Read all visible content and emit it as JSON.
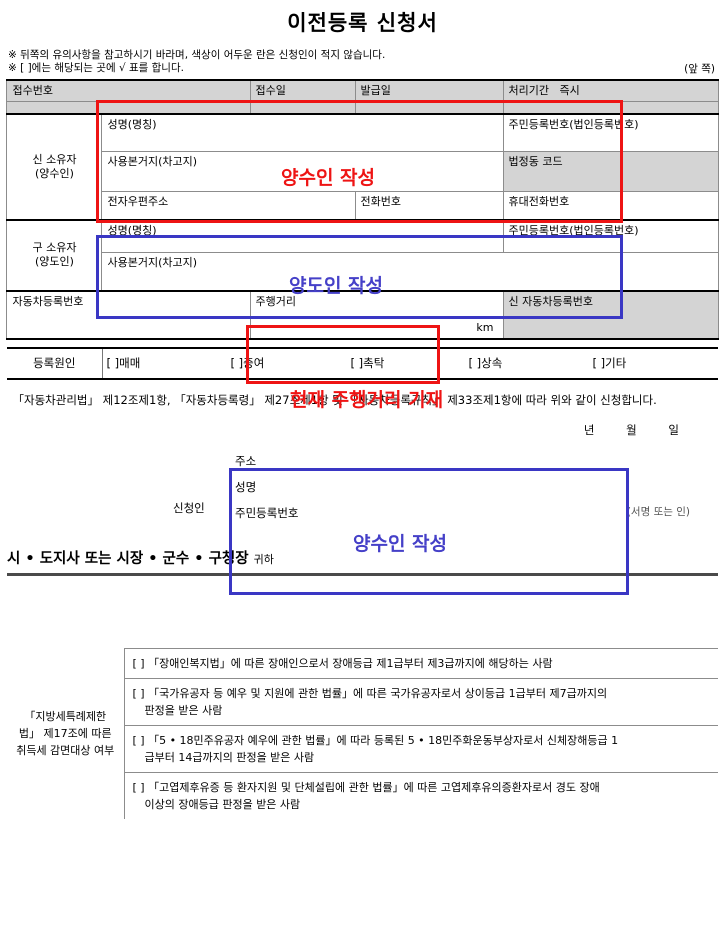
{
  "document": {
    "title": "이전등록 신청서",
    "page_mark": "(앞 쪽)",
    "notices": [
      "※ 뒤쪽의 유의사항을 참고하시기 바라며, 색상이 어두운 란은 신청인이 적지 않습니다.",
      "※ [ ]에는 해당되는 곳에 √ 표를 합니다."
    ]
  },
  "receipt_row": {
    "receipt_no_label": "접수번호",
    "receipt_date_label": "접수일",
    "issue_date_label": "발급일",
    "processing_label": "처리기간",
    "processing_value": "즉시"
  },
  "new_owner": {
    "section_label": "신 소유자",
    "section_sub": "(양수인)",
    "name_label": "성명(명칭)",
    "id_label": "주민등록번호(법인등록번호)",
    "address_label": "사용본거지(차고지)",
    "dong_code_label": "법정동 코드",
    "email_label": "전자우편주소",
    "phone_label": "전화번호",
    "mobile_label": "휴대전화번호"
  },
  "old_owner": {
    "section_label": "구 소유자",
    "section_sub": "(양도인)",
    "name_label": "성명(명칭)",
    "id_label": "주민등록번호(법인등록번호)",
    "address_label": "사용본거지(차고지)"
  },
  "vehicle": {
    "reg_no_label": "자동차등록번호",
    "mileage_label": "주행거리",
    "mileage_unit": "km",
    "new_reg_no_label": "신 자동차등록번호"
  },
  "reason": {
    "label": "등록원인",
    "options": [
      "[  ]매매",
      "[  ]증여",
      "[  ]촉탁",
      "[  ]상속",
      "[  ]기타"
    ]
  },
  "statute": {
    "text": "「자동차관리법」 제12조제1항, 「자동차등록령」 제27조제1항 및 「자동차등록규칙」 제33조제1항에 따라 위와 같이 신청합니다."
  },
  "signature": {
    "year_label": "년",
    "month_label": "월",
    "day_label": "일",
    "applicant_label": "신청인",
    "address_label": "주소",
    "name_label": "성명",
    "id_label": "주민등록번호",
    "seal_label": "(서명 또는 인)"
  },
  "addressee": {
    "text": "시 • 도지사 또는 시장 • 군수 • 구청장",
    "honorific": "귀하"
  },
  "tax_exemption": {
    "header": "「지방세특례제한법」 제17조에 따른 취득세 감면대상 여부",
    "items": [
      {
        "line1": "[ ] 「장애인복지법」에 따른 장애인으로서 장애등급 제1급부터 제3급까지에 해당하는 사람",
        "line2": ""
      },
      {
        "line1": "[ ] 「국가유공자 등 예우 및 지원에 관한 법률」에 따른 국가유공자로서 상이등급 1급부터 제7급까지의",
        "line2": "판정을 받은 사람"
      },
      {
        "line1": "[ ] 「5 • 18민주유공자 예우에 관한 법률」에 따라 등록된 5 • 18민주화운동부상자로서 신체장해등급 1",
        "line2": "급부터 14급까지의 판정을 받은 사람"
      },
      {
        "line1": "[ ] 「고엽제후유증 등 환자지원 및 단체설립에 관한 법률」에 따른 고엽제후유의증환자로서 경도 장애",
        "line2": "이상의 장애등급 판정을 받은 사람"
      }
    ]
  },
  "annotations": {
    "new_owner_note": "양수인 작성",
    "old_owner_note": "양도인 작성",
    "mileage_note": "현재 주행거리 기재",
    "signature_note": "양수인 작성",
    "colors": {
      "red": "#ee1414",
      "blue": "#4540c8"
    }
  }
}
